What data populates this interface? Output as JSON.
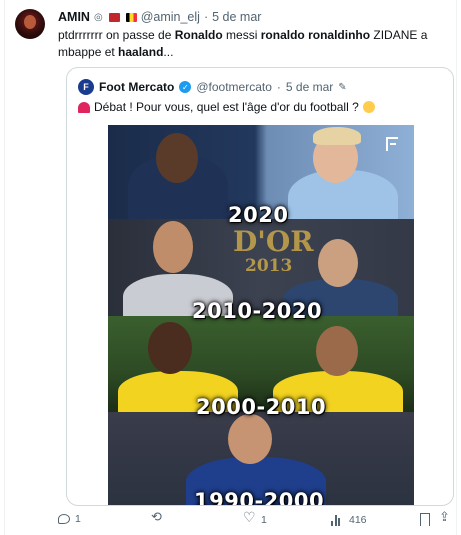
{
  "tweet": {
    "author_name": "AMIN",
    "handle": "@amin_elj",
    "separator": "·",
    "date": "5 de mar",
    "text_parts": [
      {
        "t": "ptdrrrrrrr on passe de ",
        "b": false
      },
      {
        "t": "Ronaldo",
        "b": true
      },
      {
        "t": " messi ",
        "b": false
      },
      {
        "t": "ronaldo ronaldinho",
        "b": true
      },
      {
        "t": " ZIDANE a mbappe et ",
        "b": false
      },
      {
        "t": "haaland",
        "b": true
      },
      {
        "t": "...",
        "b": false
      }
    ]
  },
  "quote": {
    "author_name": "Foot Mercato",
    "avatar_text": "F",
    "handle": "@footmercato",
    "separator": "·",
    "date": "5 de mar",
    "text": "Débat ! Pour vous, quel est l'âge d'or du football ?",
    "poster": {
      "ballon_dor_text": "D'OR",
      "ballon_dor_year": "2013",
      "eras": [
        "2020",
        "2010-2020",
        "2000-2010",
        "1990-2000"
      ]
    }
  },
  "actions": {
    "reply_count": "1",
    "retweet_count": "",
    "like_count": "1",
    "views_count": "416"
  },
  "colors": {
    "text": "#0f1419",
    "muted": "#536471",
    "border": "#cfd9de",
    "verified": "#1d9bf0"
  },
  "icons": [
    "verified-badge-icon",
    "morocco-flag-icon",
    "belgium-flag-icon",
    "verified-icon",
    "pen-icon",
    "siren-icon",
    "thinking-face-icon",
    "reply-icon",
    "retweet-icon",
    "like-icon",
    "views-icon",
    "bookmark-icon",
    "share-icon"
  ]
}
